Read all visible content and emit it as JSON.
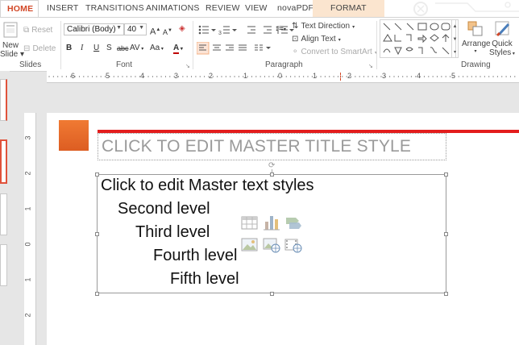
{
  "tabs": [
    {
      "label": "HOME",
      "active": true
    },
    {
      "label": "INSERT"
    },
    {
      "label": "TRANSITIONS"
    },
    {
      "label": "ANIMATIONS"
    },
    {
      "label": "REVIEW"
    },
    {
      "label": "VIEW"
    },
    {
      "label": "novaPDF"
    },
    {
      "label": "FORMAT",
      "contextual": true
    }
  ],
  "slides_group": {
    "new_slide_label_line1": "New",
    "new_slide_label_line2": "Slide",
    "reset_label": "Reset",
    "delete_label": "Delete",
    "group_label": "Slides"
  },
  "font_group": {
    "font_name": "Calibri (Body)",
    "font_size": "40",
    "bold": "B",
    "italic": "I",
    "underline": "U",
    "shadow": "S",
    "strikethrough": "abc",
    "spacing": "AV",
    "change_case": "Aa",
    "font_color": "A",
    "group_label": "Font"
  },
  "paragraph_group": {
    "text_direction": "Text Direction",
    "align_text": "Align Text",
    "convert_smartart": "Convert to SmartArt",
    "group_label": "Paragraph"
  },
  "drawing_group": {
    "arrange_label": "Arrange",
    "quick_styles_line1": "Quick",
    "quick_styles_line2": "Styles",
    "group_label": "Drawing"
  },
  "ruler": {
    "h_labels": [
      "6",
      "5",
      "4",
      "3",
      "2",
      "1",
      "0",
      "1",
      "2",
      "3",
      "4",
      "5"
    ],
    "v_labels": [
      "3",
      "2",
      "1",
      "0",
      "1",
      "2"
    ]
  },
  "slide": {
    "title_placeholder": "CLICK TO EDIT MASTER TITLE STYLE",
    "body_levels": [
      "Click to edit Master text styles",
      "Second level",
      "Third level",
      "Fourth level",
      "Fifth level"
    ],
    "accent_color": "#e96a2b",
    "line_color": "#e31d1d"
  },
  "colors": {
    "active_tab_text": "#d24726",
    "contextual_tab_bg": "#fbe5cf"
  }
}
